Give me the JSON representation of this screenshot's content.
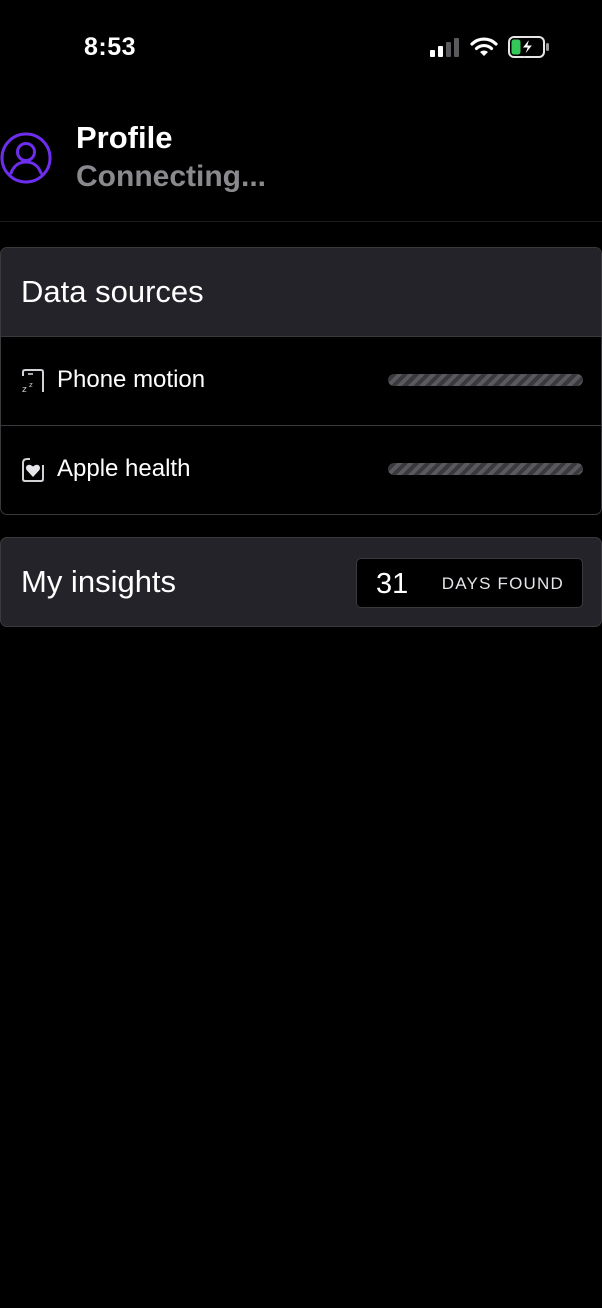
{
  "status_bar": {
    "time": "8:53",
    "icons": [
      "cellular-signal-icon",
      "wifi-icon",
      "battery-charging-icon"
    ],
    "battery_color": "#34c759"
  },
  "profile": {
    "title": "Profile",
    "status": "Connecting...",
    "avatar_icon": "user-circle-icon",
    "accent_color": "#6e2ef0"
  },
  "data_sources": {
    "title": "Data sources",
    "items": [
      {
        "label": "Phone motion",
        "icon": "sleep-phone-icon",
        "progress_state": "loading"
      },
      {
        "label": "Apple health",
        "icon": "heart-badge-icon",
        "progress_state": "loading"
      }
    ]
  },
  "insights": {
    "title": "My insights",
    "days_count": "31",
    "days_label": "DAYS FOUND"
  }
}
